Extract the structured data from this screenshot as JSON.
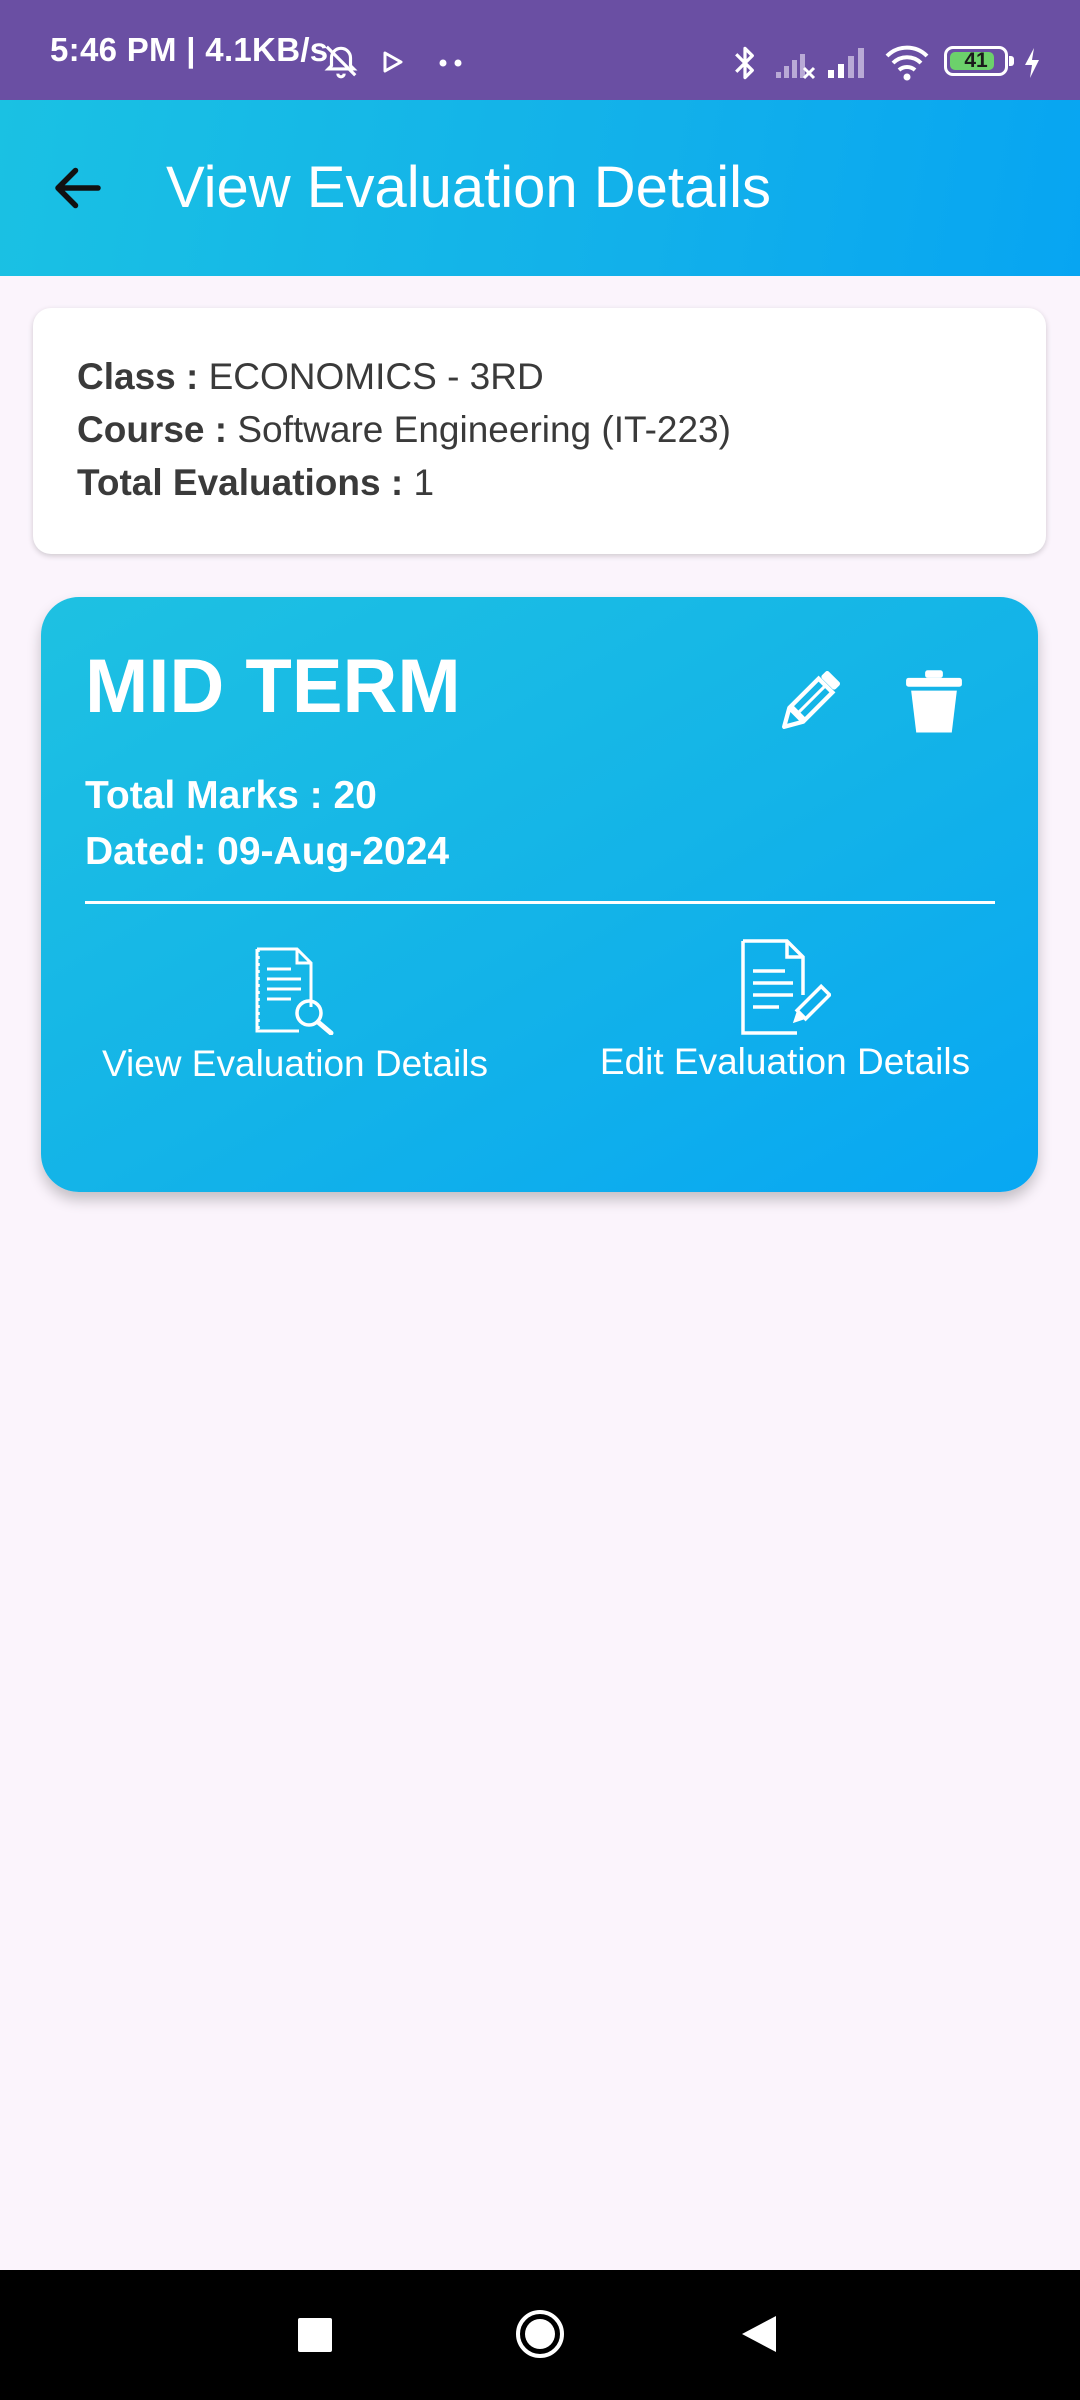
{
  "status_bar": {
    "time_text": "5:46 PM | 4.1KB/s",
    "battery_level": "41",
    "icons": [
      "alarm-off-icon",
      "play-icon",
      "more-dots-icon",
      "bluetooth-icon",
      "signal-no-service-icon",
      "signal-icon",
      "wifi-icon",
      "battery-icon",
      "charging-icon"
    ]
  },
  "app_bar": {
    "title": "View Evaluation Details",
    "back_icon": "arrow-back-icon"
  },
  "info": {
    "class_label": "Class :",
    "class_value": "ECONOMICS - 3RD",
    "course_label": "Course :",
    "course_value": "Software Engineering (IT-223)",
    "total_label": "Total Evaluations :",
    "total_value": "1"
  },
  "evaluation": {
    "title": "MID TERM",
    "total_marks": "Total Marks : 20",
    "dated": "Dated: 09-Aug-2024",
    "edit_icon": "pencil-icon",
    "delete_icon": "trash-icon",
    "view_action_label": "View Evaluation Details",
    "edit_action_label": "Edit Evaluation Details"
  },
  "nav_bar": {
    "icons": [
      "recents-square-icon",
      "home-circle-icon",
      "back-triangle-icon"
    ]
  },
  "colors": {
    "status_bar": "#6a4fa3",
    "accent": "#12b0ea",
    "background": "#fbf4fc"
  }
}
